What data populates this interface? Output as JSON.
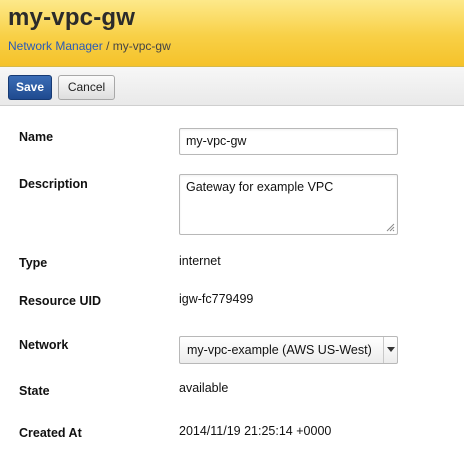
{
  "header": {
    "title": "my-vpc-gw",
    "breadcrumb": {
      "parent": "Network Manager",
      "separator": "/",
      "current": "my-vpc-gw"
    }
  },
  "toolbar": {
    "save_label": "Save",
    "cancel_label": "Cancel"
  },
  "form": {
    "name": {
      "label": "Name",
      "value": "my-vpc-gw"
    },
    "description": {
      "label": "Description",
      "value": "Gateway for example VPC"
    },
    "type": {
      "label": "Type",
      "value": "internet"
    },
    "resource_uid": {
      "label": "Resource UID",
      "value": "igw-fc779499"
    },
    "network": {
      "label": "Network",
      "selected": "my-vpc-example (AWS US-West)"
    },
    "state": {
      "label": "State",
      "value": "available"
    },
    "created_at": {
      "label": "Created At",
      "value": "2014/11/19 21:25:14 +0000"
    }
  },
  "colors": {
    "header_accent": "#f8d046",
    "primary_button": "#1f4a8f",
    "link": "#2a5bb7"
  },
  "icons": {
    "select_arrow": "chevron-down-icon",
    "textarea_grip": "resize-grip-icon"
  }
}
